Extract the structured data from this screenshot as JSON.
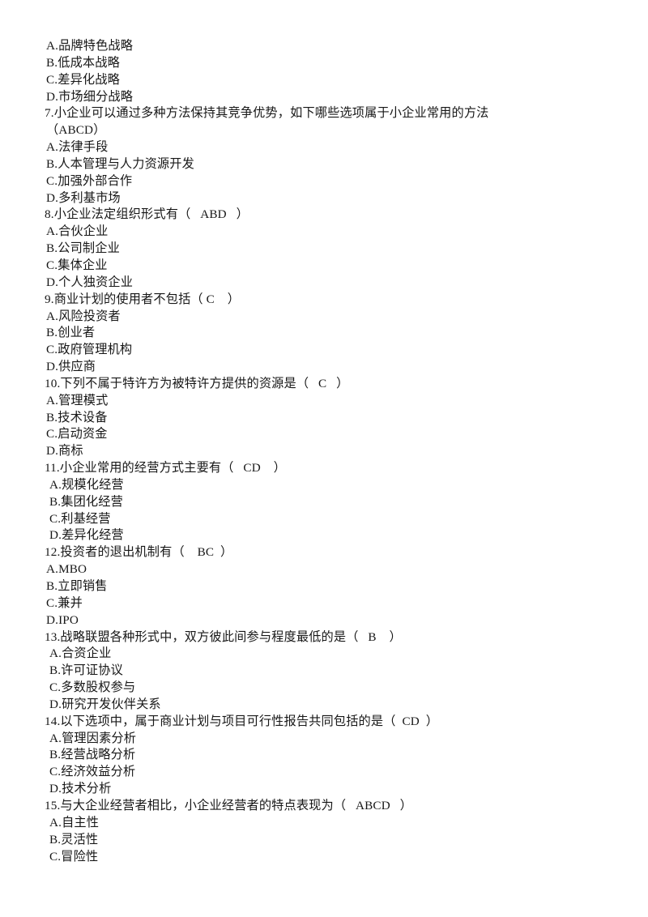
{
  "document": {
    "type": "exam-answer-sheet",
    "language": "zh-CN",
    "background_color": "#ffffff",
    "text_color": "#171717"
  },
  "lines": [
    {
      "id": "l1",
      "kind": "option",
      "text": "A.品牌特色战略"
    },
    {
      "id": "l2",
      "kind": "option",
      "text": "B.低成本战略"
    },
    {
      "id": "l3",
      "kind": "option",
      "text": "C.差异化战略"
    },
    {
      "id": "l4",
      "kind": "option",
      "text": "D.市场细分战略"
    },
    {
      "id": "l5",
      "kind": "question",
      "text": "7.小企业可以通过多种方法保持其竞争优势，如下哪些选项属于小企业常用的方法"
    },
    {
      "id": "l6",
      "kind": "answer",
      "text": "（ABCD）"
    },
    {
      "id": "l7",
      "kind": "option",
      "text": "A.法律手段"
    },
    {
      "id": "l8",
      "kind": "option",
      "text": "B.人本管理与人力资源开发"
    },
    {
      "id": "l9",
      "kind": "option",
      "text": "C.加强外部合作"
    },
    {
      "id": "l10",
      "kind": "option",
      "text": "D.多利基市场"
    },
    {
      "id": "l11",
      "kind": "question",
      "text": "8.小企业法定组织形式有（   ABD   ）"
    },
    {
      "id": "l12",
      "kind": "option",
      "text": "A.合伙企业"
    },
    {
      "id": "l13",
      "kind": "option",
      "text": "B.公司制企业"
    },
    {
      "id": "l14",
      "kind": "option",
      "text": "C.集体企业"
    },
    {
      "id": "l15",
      "kind": "option",
      "text": "D.个人独资企业"
    },
    {
      "id": "l16",
      "kind": "question",
      "text": "9.商业计划的使用者不包括（ C    ）"
    },
    {
      "id": "l17",
      "kind": "option",
      "text": "A.风险投资者"
    },
    {
      "id": "l18",
      "kind": "option",
      "text": "B.创业者"
    },
    {
      "id": "l19",
      "kind": "option",
      "text": "C.政府管理机构"
    },
    {
      "id": "l20",
      "kind": "option",
      "text": "D.供应商"
    },
    {
      "id": "l21",
      "kind": "question",
      "text": "10.下列不属于特许方为被特许方提供的资源是（   C   ）"
    },
    {
      "id": "l22",
      "kind": "option",
      "text": "A.管理模式"
    },
    {
      "id": "l23",
      "kind": "option",
      "text": "B.技术设备"
    },
    {
      "id": "l24",
      "kind": "option",
      "text": "C.启动资金"
    },
    {
      "id": "l25",
      "kind": "option",
      "text": "D.商标"
    },
    {
      "id": "l26",
      "kind": "question",
      "text": "11.小企业常用的经营方式主要有（   CD    ）"
    },
    {
      "id": "l27",
      "kind": "option",
      "text": "A.规模化经营"
    },
    {
      "id": "l28",
      "kind": "option",
      "text": "B.集团化经营"
    },
    {
      "id": "l29",
      "kind": "option",
      "text": "C.利基经营"
    },
    {
      "id": "l30",
      "kind": "option",
      "text": "D.差异化经营"
    },
    {
      "id": "l31",
      "kind": "question",
      "text": "12.投资者的退出机制有（    BC  ）"
    },
    {
      "id": "l32",
      "kind": "option",
      "text": "A.MBO"
    },
    {
      "id": "l33",
      "kind": "option",
      "text": "B.立即销售"
    },
    {
      "id": "l34",
      "kind": "option",
      "text": "C.兼并"
    },
    {
      "id": "l35",
      "kind": "option",
      "text": "D.IPO"
    },
    {
      "id": "l36",
      "kind": "question",
      "text": "13.战略联盟各种形式中，双方彼此间参与程度最低的是（   B    ）"
    },
    {
      "id": "l37",
      "kind": "option",
      "text": "A.合资企业"
    },
    {
      "id": "l38",
      "kind": "option",
      "text": "B.许可证协议"
    },
    {
      "id": "l39",
      "kind": "option",
      "text": "C.多数股权参与"
    },
    {
      "id": "l40",
      "kind": "option",
      "text": "D.研究开发伙伴关系"
    },
    {
      "id": "l41",
      "kind": "question",
      "text": "14.以下选项中，属于商业计划与项目可行性报告共同包括的是（  CD  ）"
    },
    {
      "id": "l42",
      "kind": "option",
      "text": "A.管理因素分析"
    },
    {
      "id": "l43",
      "kind": "option",
      "text": "B.经营战略分析"
    },
    {
      "id": "l44",
      "kind": "option",
      "text": "C.经济效益分析"
    },
    {
      "id": "l45",
      "kind": "option",
      "text": "D.技术分析"
    },
    {
      "id": "l46",
      "kind": "question",
      "text": "15.与大企业经营者相比，小企业经营者的特点表现为（   ABCD   ）"
    },
    {
      "id": "l47",
      "kind": "option",
      "text": "A.自主性"
    },
    {
      "id": "l48",
      "kind": "option",
      "text": "B.灵活性"
    },
    {
      "id": "l49",
      "kind": "option",
      "text": "C.冒险性"
    }
  ]
}
